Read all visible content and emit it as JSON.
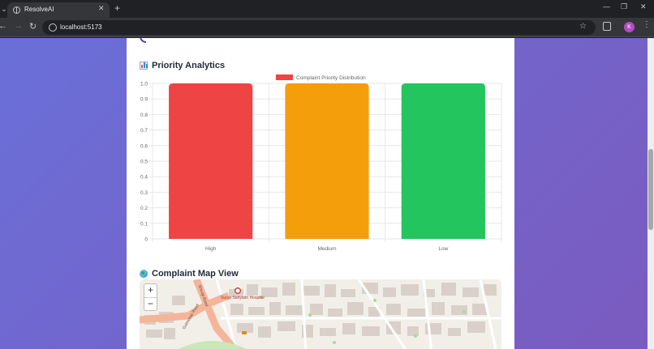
{
  "browser": {
    "tab_title": "ResolveAI",
    "url": "localhost:5173",
    "profile_initial": "K"
  },
  "sections": {
    "priority_title": "Priority Analytics",
    "map_title": "Complaint Map View"
  },
  "chart_data": {
    "type": "bar",
    "categories": [
      "High",
      "Medium",
      "Low"
    ],
    "series": [
      {
        "name": "Complaint Priority Distribution",
        "values": [
          1,
          1,
          1
        ],
        "colors": [
          "#ef4444",
          "#f59e0b",
          "#22c55e"
        ]
      }
    ],
    "ylim": [
      0,
      1
    ],
    "yticks": [
      "0",
      "0.1",
      "0.2",
      "0.3",
      "0.4",
      "0.5",
      "0.6",
      "0.7",
      "0.8",
      "0.9",
      "1.0"
    ],
    "grid": true,
    "legend": "top-center",
    "legend_color": "#ef4444"
  },
  "map": {
    "zoom_in_label": "+",
    "zoom_out_label": "−",
    "road_label_1": "Shivaji Road",
    "road_label_2": "Gulmohar Road",
    "poi_label": "Surya Sahyadri Hospital"
  }
}
